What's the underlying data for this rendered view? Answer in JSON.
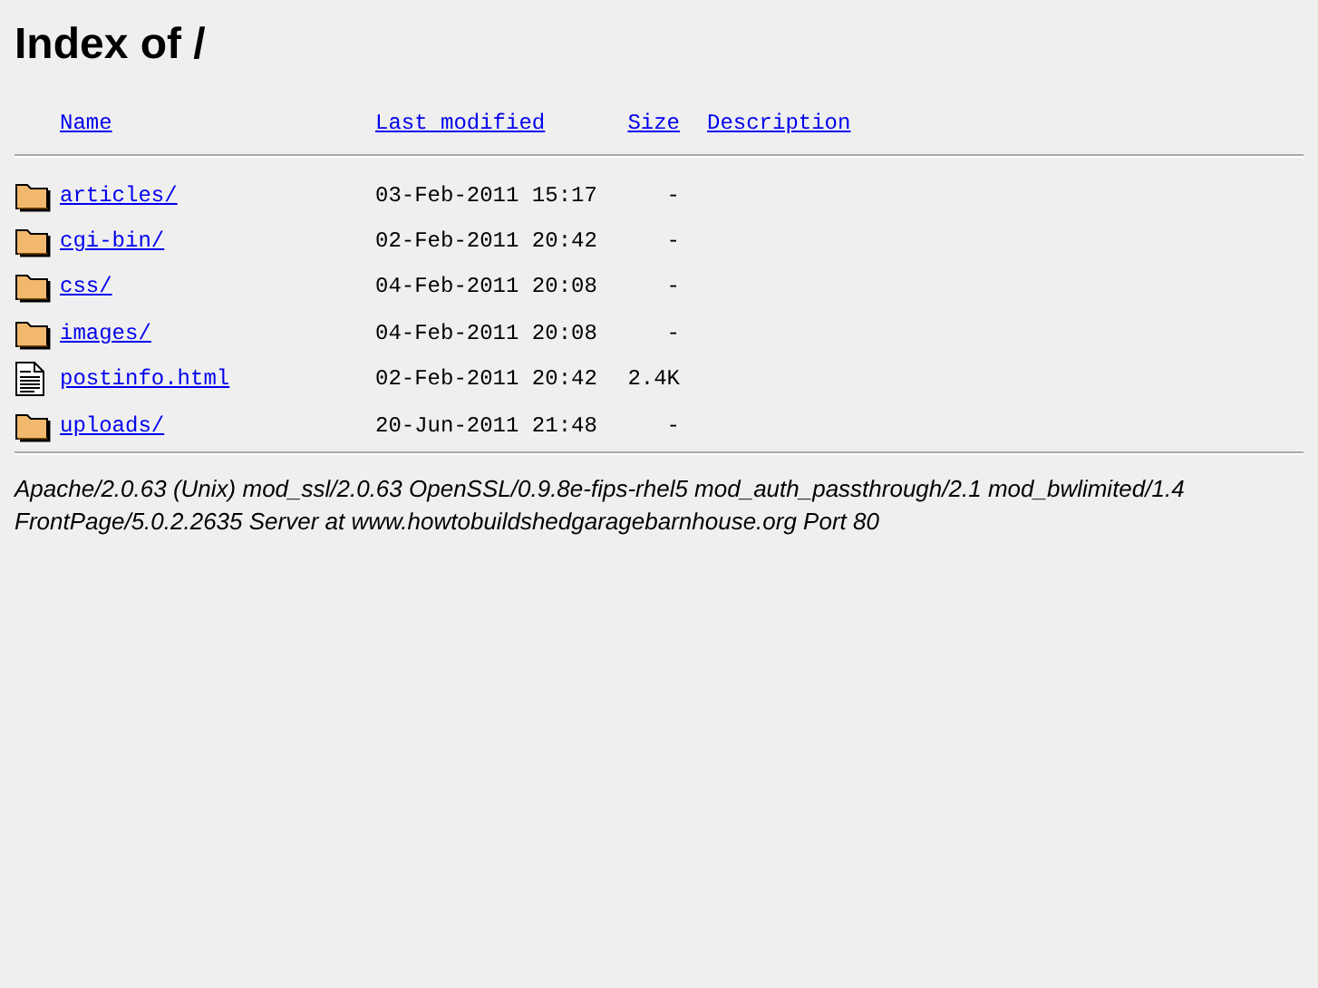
{
  "heading": "Index of /",
  "columns": [
    "Name",
    "Last modified",
    "Size",
    "Description"
  ],
  "rows": [
    {
      "kind": "folder",
      "name": "articles/",
      "modified": "03-Feb-2011 15:17",
      "size": "-"
    },
    {
      "kind": "folder",
      "name": "cgi-bin/",
      "modified": "02-Feb-2011 20:42",
      "size": "-"
    },
    {
      "kind": "folder",
      "name": "css/",
      "modified": "04-Feb-2011 20:08",
      "size": "-"
    },
    {
      "kind": "folder",
      "name": "images/",
      "modified": "04-Feb-2011 20:08",
      "size": "-"
    },
    {
      "kind": "file",
      "name": "postinfo.html",
      "modified": "02-Feb-2011 20:42",
      "size": "2.4K"
    },
    {
      "kind": "folder",
      "name": "uploads/",
      "modified": "20-Jun-2011 21:48",
      "size": "-"
    }
  ],
  "address_lines": [
    "Apache/2.0.63 (Unix) mod_ssl/2.0.63 OpenSSL/0.9.8e-fips-rhel5 mod_auth_passthrough/2.1 mod_bwlimited/1.4",
    "FrontPage/5.0.2.2635 Server at www.howtobuildshedgaragebarnhouse.org Port 80"
  ]
}
